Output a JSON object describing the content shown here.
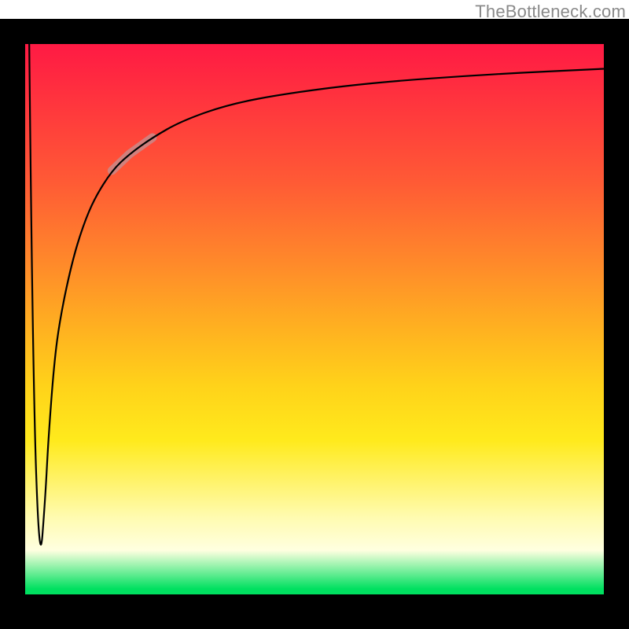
{
  "watermark": {
    "text": "TheBottleneck.com"
  },
  "chart_data": {
    "type": "line",
    "title": "",
    "xlabel": "",
    "ylabel": "",
    "xlim": [
      0,
      100
    ],
    "ylim": [
      0,
      100
    ],
    "background_gradient": {
      "direction": "top-to-bottom",
      "stops": [
        {
          "pos": 0,
          "color": "#ff1a44"
        },
        {
          "pos": 25,
          "color": "#ff5a35"
        },
        {
          "pos": 50,
          "color": "#ffb220"
        },
        {
          "pos": 75,
          "color": "#ffef2a"
        },
        {
          "pos": 92,
          "color": "#ffffe0"
        },
        {
          "pos": 100,
          "color": "#00e060"
        }
      ]
    },
    "series": [
      {
        "name": "bottleneck-curve",
        "x": [
          0.7,
          1.3,
          2.5,
          3.5,
          4.0,
          5.0,
          6.0,
          8.0,
          10.0,
          12.0,
          15.0,
          18.0,
          22.0,
          27.0,
          35.0,
          45.0,
          60.0,
          80.0,
          100.0
        ],
        "y": [
          100,
          40,
          4,
          18,
          28,
          42,
          50,
          60,
          67,
          72,
          77,
          80,
          83,
          86,
          89,
          91,
          93,
          94.5,
          95.5
        ]
      }
    ],
    "highlight_range": {
      "series": "bottleneck-curve",
      "x_start": 15,
      "x_end": 22,
      "color": "#c98a8a"
    }
  }
}
